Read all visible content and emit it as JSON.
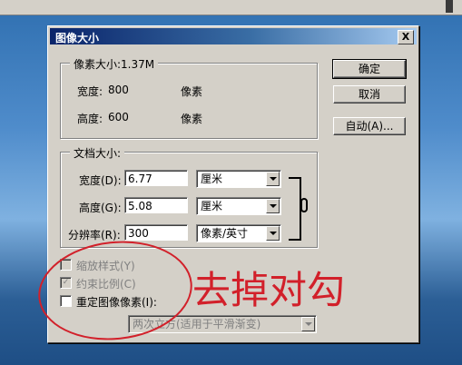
{
  "dialog": {
    "title": "图像大小",
    "close_label": "X"
  },
  "pixel_dimensions": {
    "legend": "像素大小:1.37M",
    "width_label": "宽度:",
    "width_value": "800",
    "width_unit": "像素",
    "height_label": "高度:",
    "height_value": "600",
    "height_unit": "像素"
  },
  "document_size": {
    "legend": "文档大小:",
    "width_label": "宽度(D):",
    "width_value": "6.77",
    "width_unit": "厘米",
    "height_label": "高度(G):",
    "height_value": "5.08",
    "height_unit": "厘米",
    "resolution_label": "分辨率(R):",
    "resolution_value": "300",
    "resolution_unit": "像素/英寸"
  },
  "buttons": {
    "ok": "确定",
    "cancel": "取消",
    "auto": "自动(A)..."
  },
  "options": {
    "scale_styles": {
      "label": "缩放样式(Y)",
      "checked": false,
      "enabled": false
    },
    "constrain": {
      "label": "约束比例(C)",
      "checked": true,
      "enabled": false
    },
    "resample": {
      "label": "重定图像像素(I):",
      "checked": false,
      "enabled": true
    },
    "interpolation": "两次立方(适用于平滑渐变)"
  },
  "annotation": {
    "text": "去掉对勾",
    "color": "#d2202a"
  }
}
